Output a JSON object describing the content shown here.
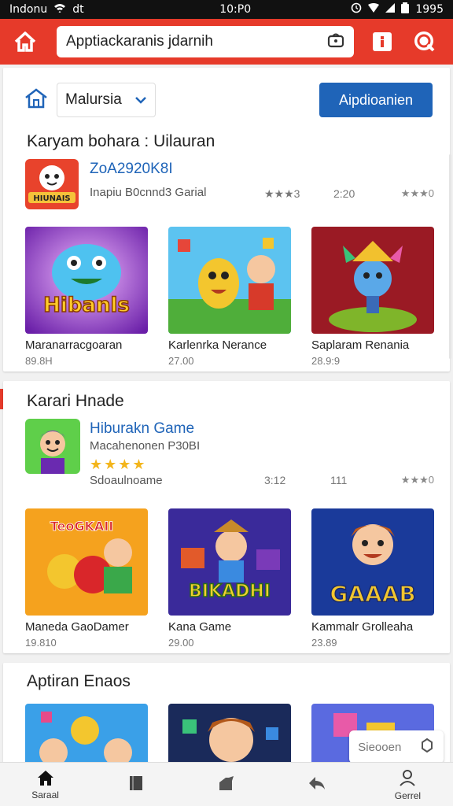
{
  "status": {
    "carrier": "Indonu",
    "wifi": "dt",
    "time": "10:P0",
    "battery": "1995"
  },
  "appbar": {
    "search_text": "Apptiackaranis jdarnih"
  },
  "filter": {
    "region": "Malursia",
    "primary_button": "Aipdioanien"
  },
  "section1": {
    "title": "Karyam bohara : Uilauran",
    "featured": {
      "name": "ZoA2920K8I",
      "sub": "Inapiu B0cnnd3 Garial",
      "meta": "2:20",
      "rating_left": "★★★3",
      "rating_right": "★★★0"
    },
    "tiles": [
      {
        "name": "Maranarracgoaran",
        "size": "89.8H",
        "art_text": "Hibanls"
      },
      {
        "name": "Karlenrka Nerance",
        "size": "27.00"
      },
      {
        "name": "Saplaram Renania",
        "size": "28.9:9"
      }
    ]
  },
  "section2": {
    "title": "Karari Hnade",
    "featured": {
      "name": "Hiburakn Game",
      "sub": "Macahenonen P30BI",
      "stars": "★★★★",
      "label": "Sdoaulnoame",
      "meta1": "3:12",
      "meta2": "111",
      "rating": "★★★0"
    },
    "tiles": [
      {
        "name": "Maneda GaoDamer",
        "size": "19.810",
        "art_text": "TeoGKAII"
      },
      {
        "name": "Kana Game",
        "size": "29.00",
        "art_text": "BIKADHI"
      },
      {
        "name": "Kammalr Grolleaha",
        "size": "23.89",
        "art_text": "GAAAB"
      }
    ]
  },
  "section3": {
    "title": "Aptiran Enaos",
    "float_label": "Sieooen"
  },
  "bottomnav": [
    {
      "label": "Saraal",
      "icon": "home-icon"
    },
    {
      "label": "",
      "icon": "book-icon"
    },
    {
      "label": "",
      "icon": "share-icon"
    },
    {
      "label": "",
      "icon": "back-icon"
    },
    {
      "label": "Gerrel",
      "icon": "profile-icon"
    }
  ],
  "colors": {
    "brand": "#e63a2a",
    "primary": "#1f64b8",
    "star": "#f3b51b"
  }
}
